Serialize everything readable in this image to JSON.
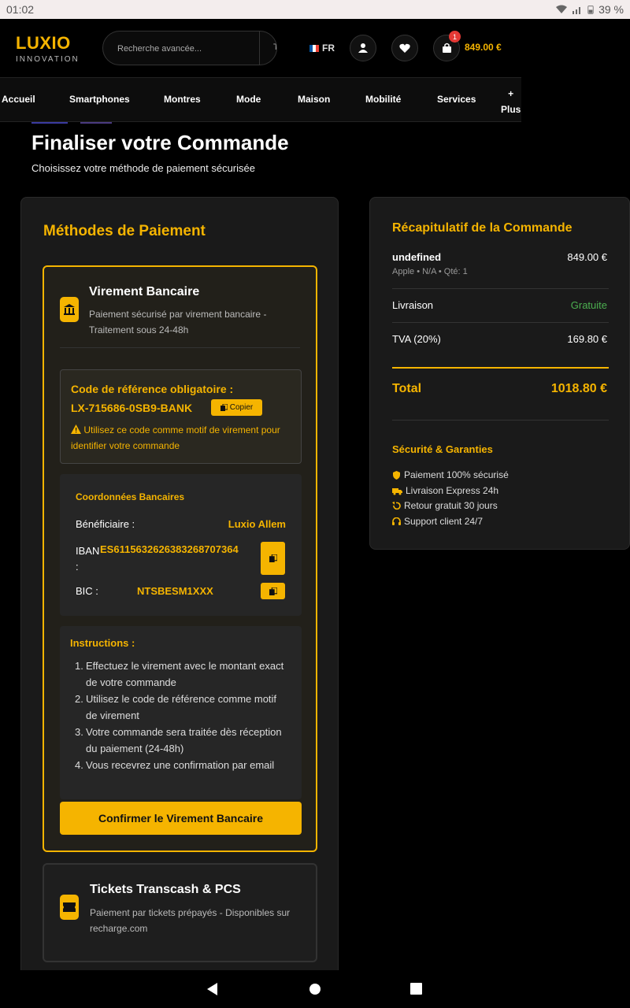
{
  "status_bar": {
    "time": "01:02",
    "battery": "39 %"
  },
  "header": {
    "logo_name": "LUXIO",
    "logo_sub": "INNOVATION",
    "search_placeholder": "Recherche avancée...",
    "search_trunc": "T",
    "lang": "FR",
    "cart_count": "1",
    "cart_total": "849.00 €"
  },
  "nav": {
    "items": [
      "Accueil",
      "Smartphones",
      "Montres",
      "Mode",
      "Maison",
      "Mobilité",
      "Services"
    ],
    "plus_symbol": "+",
    "plus_label": "Plus"
  },
  "page": {
    "title": "Finaliser votre Commande",
    "subtitle": "Choisissez votre méthode de paiement sécurisée"
  },
  "payment": {
    "section_title": "Méthodes de Paiement",
    "bank": {
      "title": "Virement Bancaire",
      "desc": "Paiement sécurisé par virement bancaire - Traitement sous 24-48h",
      "ref_label": "Code de référence obligatoire :",
      "ref_code": "LX-715686-0SB9-BANK",
      "copy_label": "Copier",
      "ref_warning": "Utilisez ce code comme motif de virement pour identifier votre commande",
      "coords_title": "Coordonnées Bancaires",
      "beneficiary_label": "Bénéficiaire :",
      "beneficiary_value": "Luxio Allem",
      "iban_label": "IBAN :",
      "iban_value": "ES6115632626383268707364",
      "bic_label": "BIC :",
      "bic_value": "NTSBESM1XXX",
      "instructions_title": "Instructions :",
      "instructions": [
        "Effectuez le virement avec le montant exact de votre commande",
        "Utilisez le code de référence comme motif de virement",
        "Votre commande sera traitée dès réception du paiement (24-48h)",
        "Vous recevrez une confirmation par email"
      ],
      "confirm_label": "Confirmer le Virement Bancaire"
    },
    "tickets": {
      "title": "Tickets Transcash & PCS",
      "desc": "Paiement par tickets prépayés - Disponibles sur recharge.com"
    }
  },
  "summary": {
    "title": "Récapitulatif de la Commande",
    "product_name": "undefined",
    "product_price": "849.00 €",
    "product_meta": "Apple • N/A • Qté: 1",
    "delivery_label": "Livraison",
    "delivery_value": "Gratuite",
    "vat_label": "TVA (20%)",
    "vat_value": "169.80 €",
    "total_label": "Total",
    "total_value": "1018.80 €",
    "guarantees_title": "Sécurité & Garanties",
    "guarantees": [
      "Paiement 100% sécurisé",
      "Livraison Express 24h",
      "Retour gratuit 30 jours",
      "Support client 24/7"
    ]
  },
  "colors": {
    "accent": "#f5b400",
    "success": "#4caf50",
    "background": "#000000",
    "card": "#1a1a1a"
  }
}
